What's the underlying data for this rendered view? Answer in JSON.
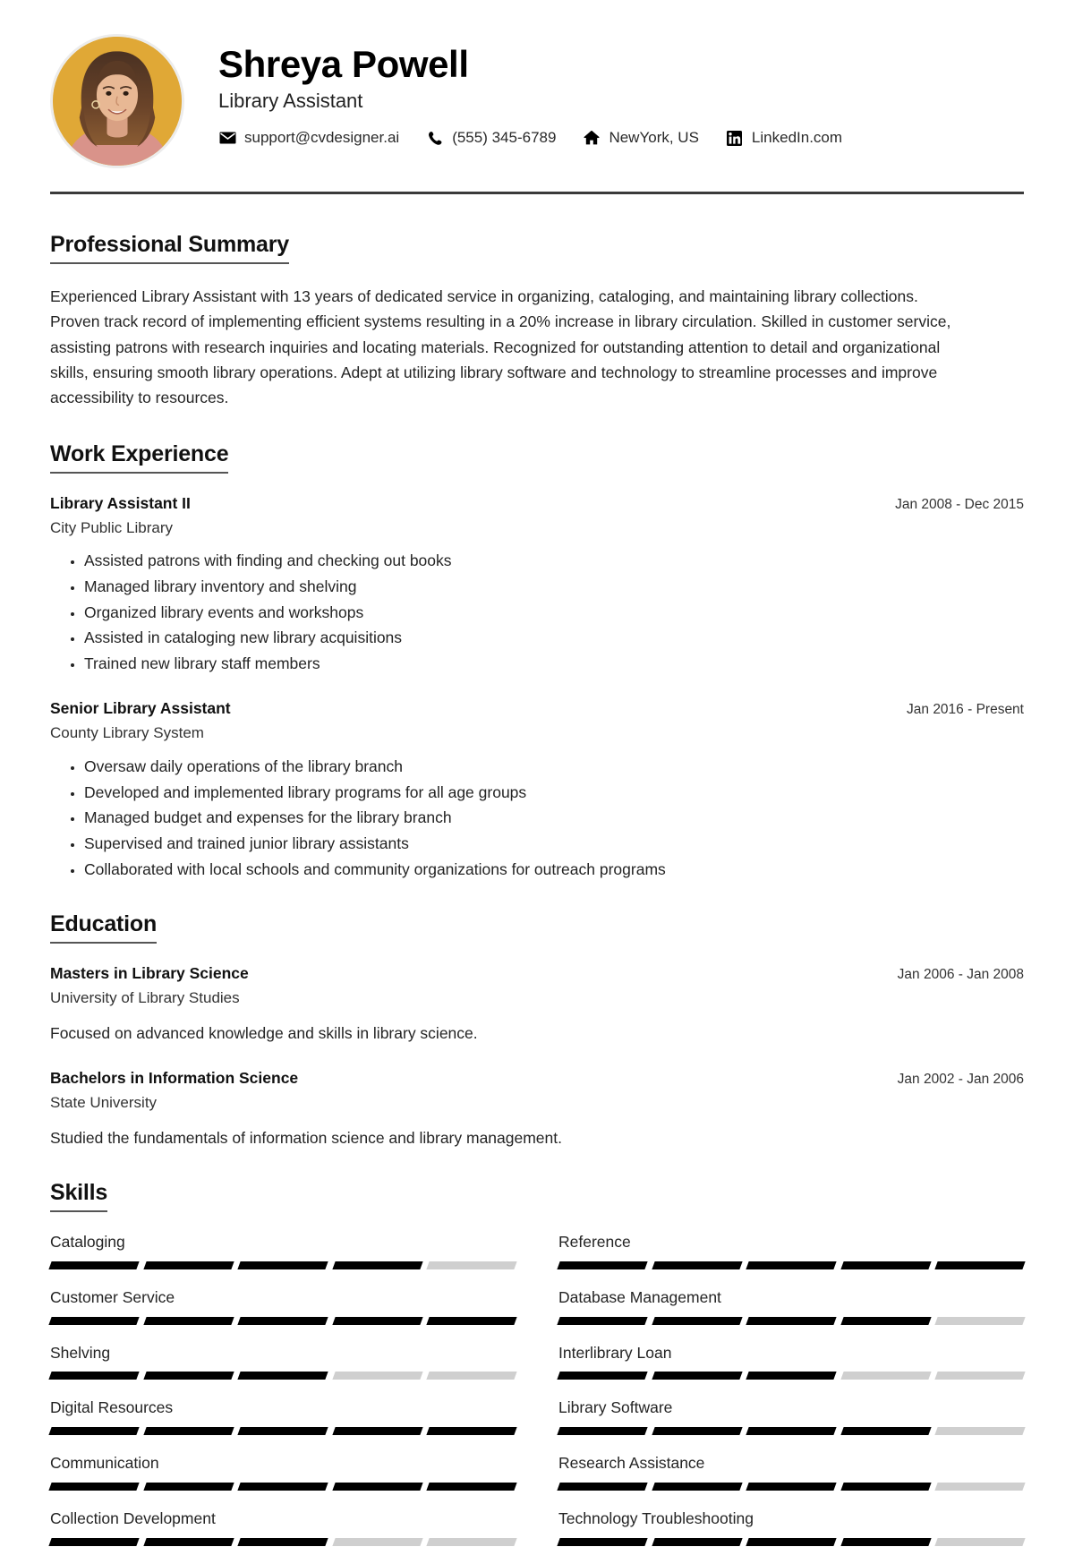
{
  "header": {
    "name": "Shreya Powell",
    "job_title": "Library Assistant",
    "avatar_alt": "profile-photo",
    "contacts": [
      {
        "icon": "envelope-icon",
        "value": "support@cvdesigner.ai"
      },
      {
        "icon": "phone-icon",
        "value": "(555) 345-6789"
      },
      {
        "icon": "home-icon",
        "value": "NewYork, US"
      },
      {
        "icon": "linkedin-icon",
        "value": "LinkedIn.com"
      }
    ]
  },
  "sections": {
    "summary": {
      "title": "Professional Summary",
      "text": "Experienced Library Assistant with 13 years of dedicated service in organizing, cataloging, and maintaining library collections. Proven track record of implementing efficient systems resulting in a 20% increase in library circulation. Skilled in customer service, assisting patrons with research inquiries and locating materials. Recognized for outstanding attention to detail and organizational skills, ensuring smooth library operations. Adept at utilizing library software and technology to streamline processes and improve accessibility to resources."
    },
    "work": {
      "title": "Work Experience",
      "entries": [
        {
          "role": "Library Assistant II",
          "organization": "City Public Library",
          "date": "Jan 2008 - Dec 2015",
          "bullets": [
            "Assisted patrons with finding and checking out books",
            "Managed library inventory and shelving",
            "Organized library events and workshops",
            "Assisted in cataloging new library acquisitions",
            "Trained new library staff members"
          ]
        },
        {
          "role": "Senior Library Assistant",
          "organization": "County Library System",
          "date": "Jan 2016 - Present",
          "bullets": [
            "Oversaw daily operations of the library branch",
            "Developed and implemented library programs for all age groups",
            "Managed budget and expenses for the library branch",
            "Supervised and trained junior library assistants",
            "Collaborated with local schools and community organizations for outreach programs"
          ]
        }
      ]
    },
    "education": {
      "title": "Education",
      "entries": [
        {
          "degree": "Masters in Library Science",
          "school": "University of Library Studies",
          "date": "Jan 2006 - Jan 2008",
          "description": "Focused on advanced knowledge and skills in library science."
        },
        {
          "degree": "Bachelors in Information Science",
          "school": "State University",
          "date": "Jan 2002 - Jan 2006",
          "description": "Studied the fundamentals of information science and library management."
        }
      ]
    },
    "skills": {
      "title": "Skills",
      "max_level": 5,
      "items": [
        {
          "name": "Cataloging",
          "level": 4
        },
        {
          "name": "Reference",
          "level": 5
        },
        {
          "name": "Customer Service",
          "level": 5
        },
        {
          "name": "Database Management",
          "level": 4
        },
        {
          "name": "Shelving",
          "level": 3
        },
        {
          "name": "Interlibrary Loan",
          "level": 3
        },
        {
          "name": "Digital Resources",
          "level": 5
        },
        {
          "name": "Library Software",
          "level": 4
        },
        {
          "name": "Communication",
          "level": 5
        },
        {
          "name": "Research Assistance",
          "level": 4
        },
        {
          "name": "Collection Development",
          "level": 3
        },
        {
          "name": "Technology Troubleshooting",
          "level": 4
        }
      ]
    }
  },
  "colors": {
    "accent_avatar_bg": "#e0a836",
    "rule": "#3a3a3a",
    "skill_filled": "#000000",
    "skill_empty": "#cfcfcf",
    "text": "#242424"
  }
}
